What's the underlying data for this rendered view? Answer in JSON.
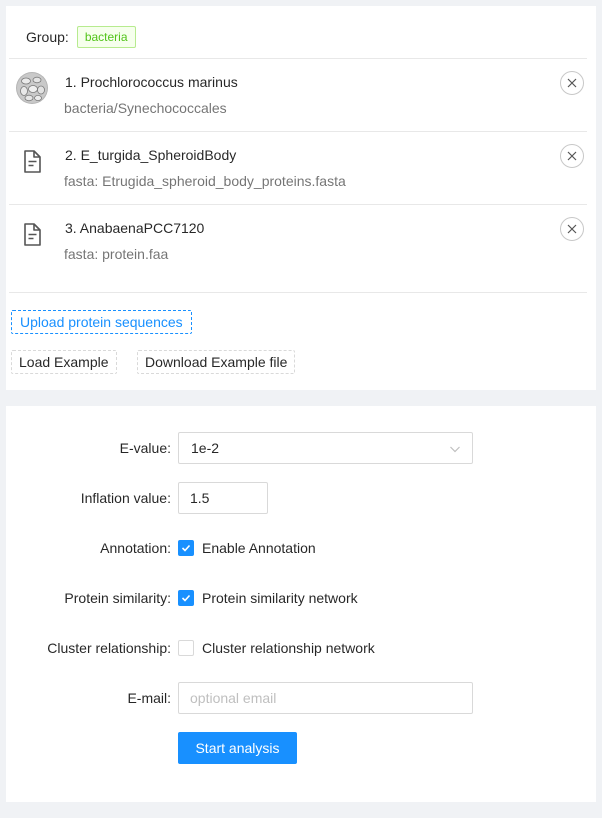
{
  "group": {
    "label": "Group:",
    "tag": "bacteria"
  },
  "items": [
    {
      "title": "1. Prochlorococcus marinus",
      "desc": "bacteria/Synechococcales",
      "icon": "organism-thumbnail-icon"
    },
    {
      "title": "2. E_turgida_SpheroidBody",
      "desc": "fasta:  Etrugida_spheroid_body_proteins.fasta",
      "icon": "file-icon"
    },
    {
      "title": "3. AnabaenaPCC7120",
      "desc": "fasta:  protein.faa",
      "icon": "file-icon"
    }
  ],
  "buttons": {
    "upload": "Upload protein sequences",
    "load_example": "Load Example",
    "download_example": "Download Example file",
    "start": "Start analysis"
  },
  "form": {
    "evalue": {
      "label": "E-value:",
      "value": "1e-2"
    },
    "inflation": {
      "label": "Inflation value:",
      "value": "1.5"
    },
    "annotation": {
      "label": "Annotation:",
      "text": "Enable Annotation",
      "checked": true
    },
    "similarity": {
      "label": "Protein similarity:",
      "text": "Protein similarity network",
      "checked": true
    },
    "cluster": {
      "label": "Cluster relationship:",
      "text": "Cluster relationship network",
      "checked": false
    },
    "email": {
      "label": "E-mail:",
      "placeholder": "optional email",
      "value": ""
    }
  },
  "colors": {
    "primary": "#1890ff",
    "tag_green": "#52c41a",
    "background": "#f0f2f5"
  }
}
